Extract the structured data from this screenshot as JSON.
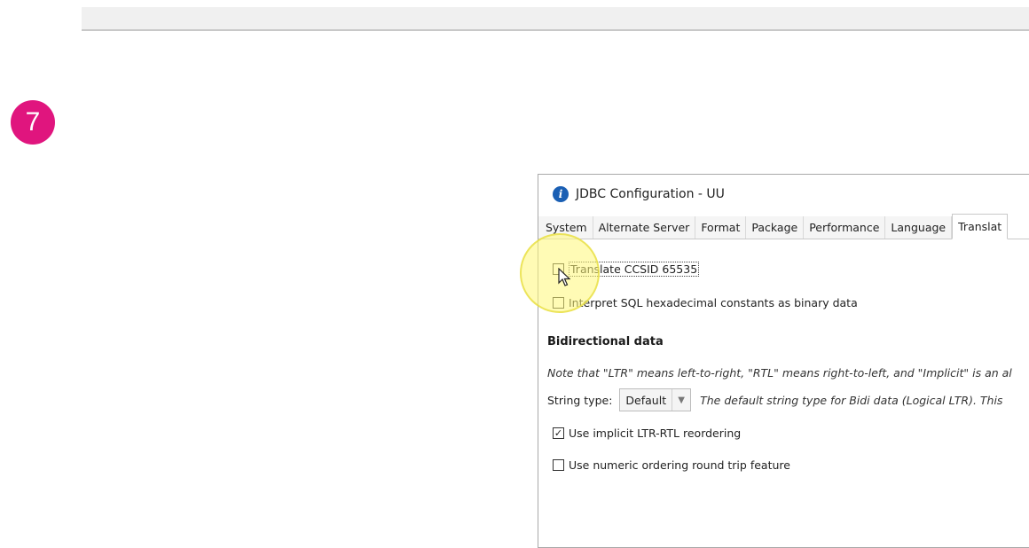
{
  "step": {
    "number": "7",
    "color": "#e0157e"
  },
  "dialog": {
    "title": "JDBC Configuration - UU",
    "app_icon": "info-i-icon",
    "tabs": [
      "System",
      "Alternate Server",
      "Format",
      "Package",
      "Performance",
      "Language",
      "Translat"
    ],
    "active_tab_index": 6,
    "options": {
      "translate_ccsid": {
        "label": "Translate CCSID 65535",
        "checked": false
      },
      "interpret_hex": {
        "label": "Interpret SQL hexadecimal constants as binary data",
        "checked": false
      }
    },
    "bidi": {
      "heading": "Bidirectional data",
      "note": "Note that \"LTR\" means left-to-right, \"RTL\" means right-to-left, and \"Implicit\" is an al",
      "string_type_label": "String type:",
      "string_type_value": "Default",
      "string_type_desc": "The default string type for Bidi data (Logical LTR). This",
      "implicit_reordering": {
        "label": "Use implicit LTR-RTL reordering",
        "checked": true
      },
      "numeric_round_trip": {
        "label": "Use numeric ordering round trip feature",
        "checked": false
      }
    }
  }
}
